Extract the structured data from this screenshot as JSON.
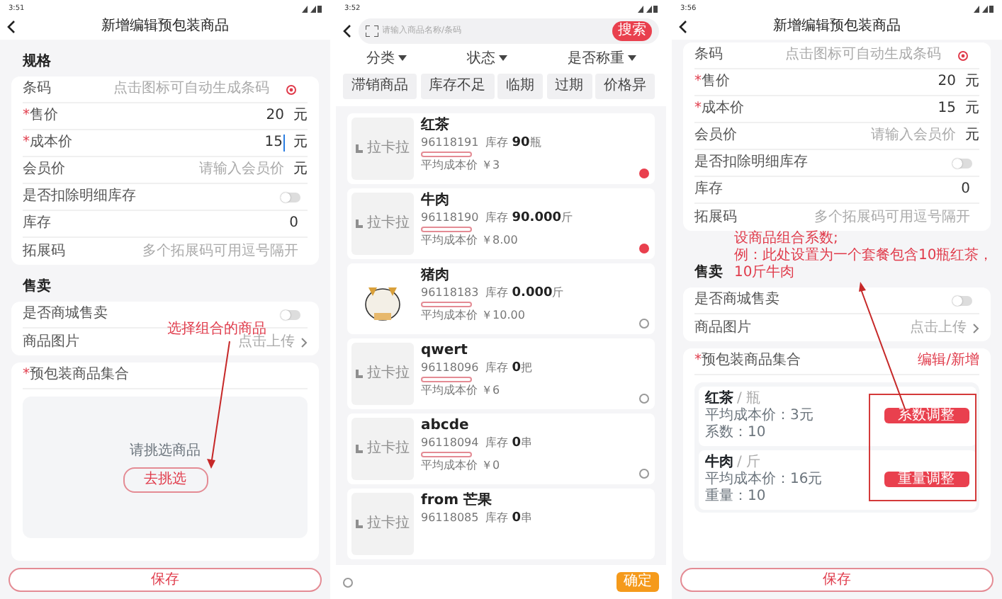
{
  "screens": [
    {
      "kind": "form",
      "status_time": "3:51",
      "title": "新增编辑预包装商品",
      "sections": [
        {
          "heading": "规格",
          "rows": [
            {
              "kind": "barcode",
              "label": "条码",
              "placeholder": "点击图标可自动生成条码"
            },
            {
              "kind": "input",
              "required_mark": "*",
              "label": "售价",
              "value": "20",
              "unit": "元"
            },
            {
              "kind": "input",
              "required_mark": "*",
              "label": "成本价",
              "value": "15",
              "unit": "元",
              "focused": true
            },
            {
              "kind": "input",
              "label": "会员价",
              "placeholder": "请输入会员价",
              "unit": "元"
            },
            {
              "kind": "toggle",
              "label": "是否扣除明细库存",
              "on": false
            },
            {
              "kind": "input",
              "label": "库存",
              "value": "0"
            },
            {
              "kind": "input",
              "label": "拓展码",
              "placeholder": "多个拓展码可用逗号隔开"
            }
          ]
        },
        {
          "heading": "售卖",
          "rows": [
            {
              "kind": "toggle",
              "label": "是否商城售卖",
              "on": false
            },
            {
              "kind": "link",
              "label": "商品图片",
              "value": "点击上传"
            }
          ]
        }
      ],
      "collection": {
        "required_mark": "*",
        "label": "预包装商品集合",
        "empty_text": "请挑选商品",
        "pick_button": "去挑选"
      },
      "annotation": {
        "lines": [
          "选择组合的商品"
        ]
      },
      "save": "保存"
    },
    {
      "kind": "picker",
      "status_time": "3:52",
      "search": {
        "placeholder": "请输入商品名称/条码",
        "button": "搜索"
      },
      "filters": [
        "分类",
        "状态",
        "是否称重"
      ],
      "chips": [
        "滞销商品",
        "库存不足",
        "临期",
        "过期",
        "价格异"
      ],
      "products": [
        {
          "name": "红茶",
          "code": "96118191",
          "stock": "库存 **90**瓶",
          "avg": "平均成本价  ￥3",
          "thumb_text": "拉卡拉",
          "selected": true
        },
        {
          "name": "牛肉",
          "code": "96118190",
          "stock": "库存 **90.000**斤",
          "avg": "平均成本价  ￥8.00",
          "thumb_text": "拉卡拉",
          "selected": true
        },
        {
          "name": "猪肉",
          "code": "96118183",
          "stock": "库存 **0.000**斤",
          "avg": "平均成本价  ￥10.00",
          "selected": false
        },
        {
          "name": "qwert",
          "code": "96118096",
          "stock": "库存 **0**把",
          "avg": "平均成本价  ￥6",
          "thumb_text": "拉卡拉",
          "selected": false
        },
        {
          "name": "abcde",
          "code": "96118094",
          "stock": "库存 **0**串",
          "avg": "平均成本价  ￥0",
          "thumb_text": "拉卡拉",
          "selected": false
        },
        {
          "name": "from 芒果",
          "code": "96118085",
          "stock": "库存 **0**串",
          "thumb_text": "拉卡拉"
        }
      ],
      "bottom": {
        "all_selected": false,
        "confirm": "确定"
      }
    },
    {
      "kind": "form",
      "status_time": "3:56",
      "title": "新增编辑预包装商品",
      "sections": [
        {
          "rows": [
            {
              "kind": "barcode",
              "label": "条码",
              "placeholder": "点击图标可自动生成条码"
            },
            {
              "kind": "input",
              "required_mark": "*",
              "label": "售价",
              "value": "20",
              "unit": "元"
            },
            {
              "kind": "input",
              "required_mark": "*",
              "label": "成本价",
              "value": "15",
              "unit": "元",
              "focused": false
            },
            {
              "kind": "input",
              "label": "会员价",
              "placeholder": "请输入会员价",
              "unit": "元"
            },
            {
              "kind": "toggle",
              "label": "是否扣除明细库存",
              "on": false
            },
            {
              "kind": "input",
              "label": "库存",
              "value": "0"
            },
            {
              "kind": "input",
              "label": "拓展码",
              "placeholder": "多个拓展码可用逗号隔开"
            }
          ]
        },
        {
          "heading": "售卖",
          "rows": [
            {
              "kind": "toggle",
              "label": "是否商城售卖",
              "on": false
            },
            {
              "kind": "link",
              "label": "商品图片",
              "value": "点击上传"
            }
          ]
        }
      ],
      "collection": {
        "required_mark": "*",
        "label": "预包装商品集合",
        "action": "编辑/新增",
        "items": [
          {
            "name": "红茶",
            "unit": "/ 瓶",
            "cost": "平均成本价：3元",
            "factor": "系数：10",
            "button": "系数调整"
          },
          {
            "name": "牛肉",
            "unit": "/ 斤",
            "cost": "平均成本价：16元",
            "factor": "重量：10",
            "button": "重量调整"
          }
        ]
      },
      "annotation": {
        "lines": [
          "设商品组合系数;",
          "例：此处设置为一个套餐包含10瓶红茶，10斤牛肉"
        ],
        "highlight": true
      },
      "save": "保存"
    }
  ]
}
